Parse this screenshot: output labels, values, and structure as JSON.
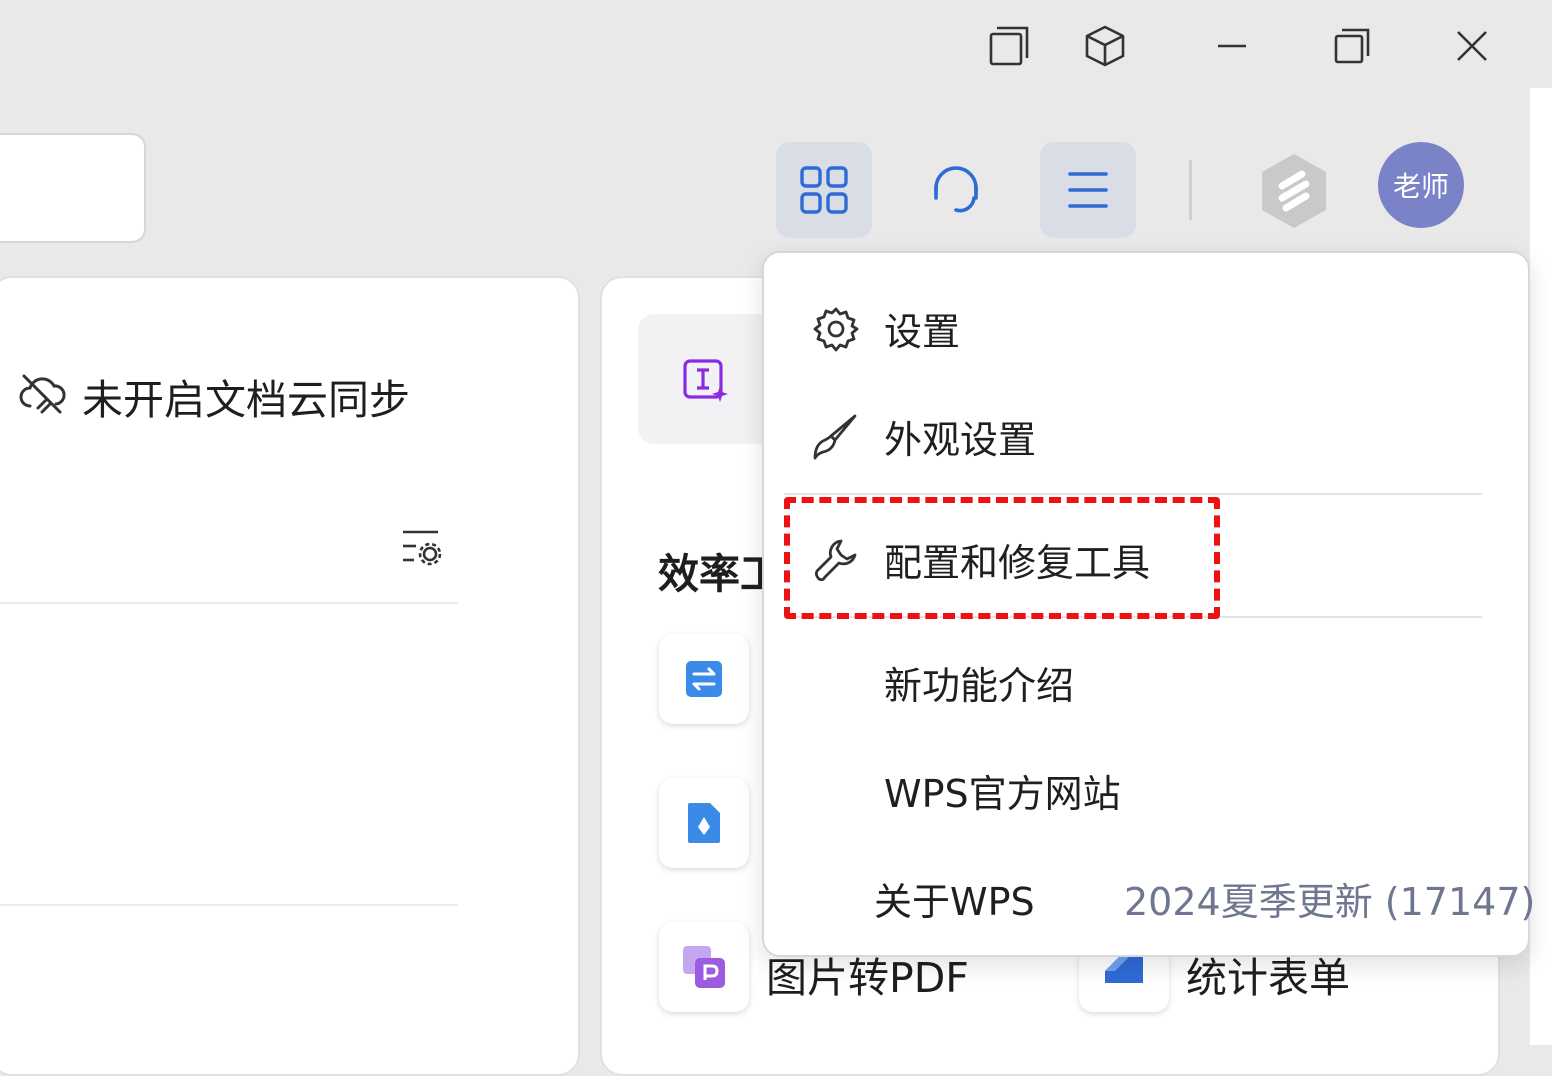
{
  "window_controls": {
    "icons": [
      "restore-window-icon",
      "cube-icon",
      "minimize-icon",
      "maximize-icon",
      "close-icon"
    ]
  },
  "header": {
    "avatar_label": "老师",
    "buttons": [
      "apps-grid-icon",
      "headset-icon",
      "menu-icon",
      "wps-logo-icon"
    ]
  },
  "left_panel": {
    "sync_status": "未开启文档云同步"
  },
  "mid_panel": {
    "tools_title": "效率工",
    "tools": [
      {
        "label": "图片转PDF",
        "icon": "image-to-pdf-icon"
      },
      {
        "label": "统计表单",
        "icon": "form-stats-icon"
      }
    ]
  },
  "menu": {
    "items": [
      {
        "label": "设置",
        "icon": "gear-icon"
      },
      {
        "label": "外观设置",
        "icon": "brush-icon"
      },
      {
        "label": "配置和修复工具",
        "icon": "wrench-icon"
      },
      {
        "label": "新功能介绍"
      },
      {
        "label": "WPS官方网站"
      },
      {
        "label": "关于WPS"
      }
    ],
    "version": "2024夏季更新 (17147)"
  },
  "colors": {
    "highlight_border": "#ee1111",
    "avatar_bg": "#7b83c8",
    "active_btn_bg": "#d9dee6",
    "icon_blue": "#2f6bd6"
  }
}
